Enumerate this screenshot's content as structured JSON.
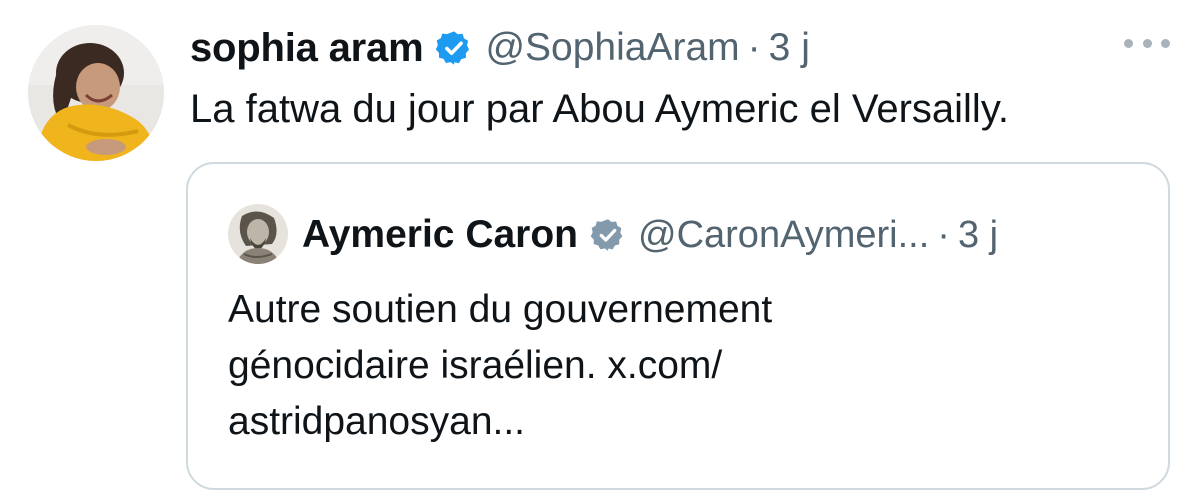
{
  "tweet": {
    "author_name": "sophia aram",
    "handle": "@SophiaAram",
    "separator": "·",
    "time": "3 j",
    "text": "La fatwa du jour par Abou Aymeric el Versailly.",
    "verified_icon": "verified-badge-icon",
    "more_icon": "more-options-icon"
  },
  "quoted_tweet": {
    "author_name": "Aymeric Caron",
    "handle": "@CaronAymeri...",
    "separator": "·",
    "time": "3 j",
    "text_lines": [
      "Autre soutien du gouvernement",
      "génocidaire israélien. x.com/",
      "astridpanosyan..."
    ],
    "verified_icon": "verified-badge-gray-icon"
  },
  "colors": {
    "verified_blue": "#1d9bf0",
    "verified_gray": "#829aab",
    "secondary_text": "#536471",
    "border": "#cfd9de"
  }
}
